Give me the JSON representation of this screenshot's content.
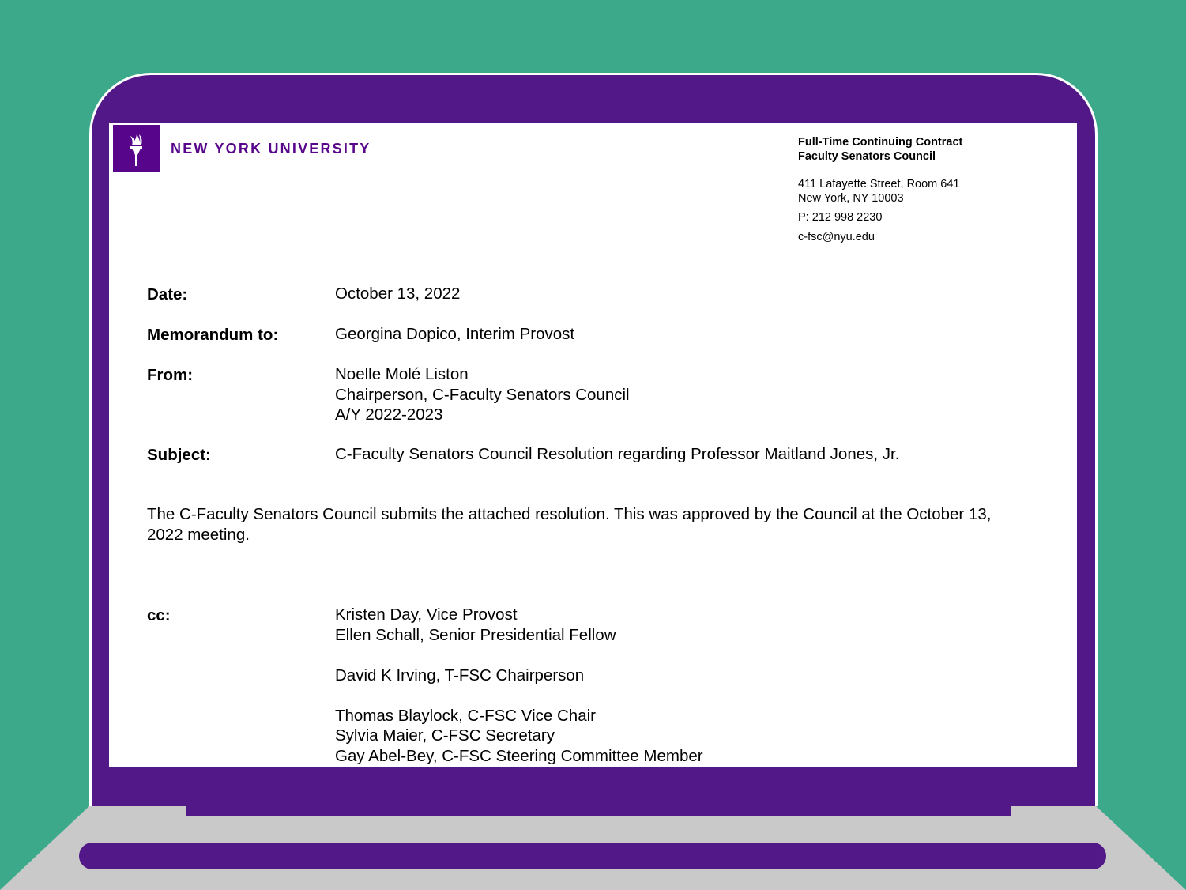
{
  "letterhead": {
    "wordmark": "NEW YORK UNIVERSITY",
    "council_line1": "Full-Time Continuing Contract",
    "council_line2": "Faculty Senators Council",
    "address_line1": "411 Lafayette Street, Room 641",
    "address_line2": "New York, NY 10003",
    "phone": "P: 212 998 2230",
    "email": "c-fsc@nyu.edu",
    "brand_color": "#57068c"
  },
  "memo": {
    "date_label": "Date:",
    "date_value": "October 13, 2022",
    "to_label": "Memorandum to:",
    "to_value": "Georgina Dopico, Interim Provost",
    "from_label": "From:",
    "from_name": "Noelle Molé Liston",
    "from_title": "Chairperson, C-Faculty Senators Council",
    "from_year": "A/Y 2022-2023",
    "subject_label": "Subject:",
    "subject_value": "C-Faculty Senators Council Resolution regarding Professor Maitland Jones, Jr.",
    "body": "The C-Faculty Senators Council submits the attached resolution. This was approved by the Council at the October 13, 2022 meeting.",
    "cc_label": "cc:",
    "cc": [
      "Kristen Day, Vice Provost",
      "Ellen Schall, Senior Presidential Fellow",
      "David K Irving, T-FSC Chairperson",
      "Thomas Blaylock, C-FSC Vice Chair",
      "Sylvia Maier, C-FSC Secretary",
      "Gay Abel-Bey, C-FSC Steering Committee Member"
    ]
  },
  "colors": {
    "background": "#3ca98a",
    "laptop_frame": "#521887",
    "laptop_base": "#c9c9c9"
  }
}
